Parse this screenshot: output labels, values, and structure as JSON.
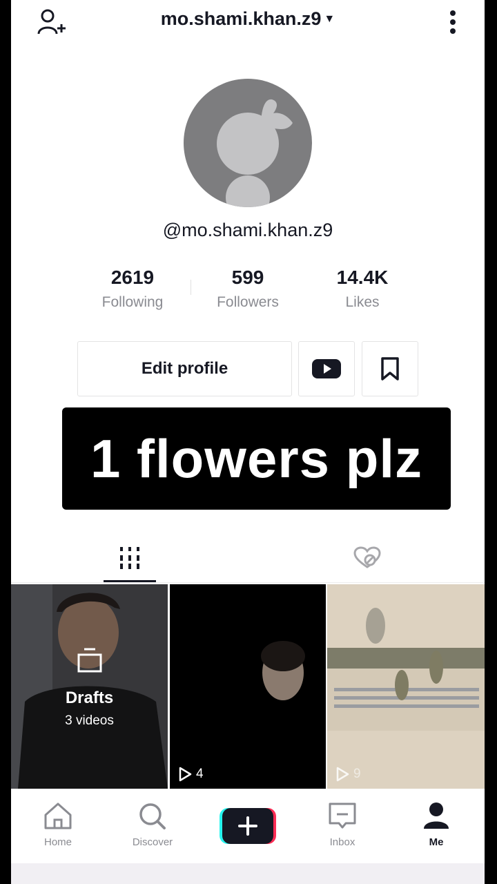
{
  "header": {
    "username": "mo.shami.khan.z9"
  },
  "profile": {
    "handle": "@mo.shami.khan.z9"
  },
  "stats": [
    {
      "value": "2619",
      "label": "Following"
    },
    {
      "value": "599",
      "label": "Followers"
    },
    {
      "value": "14.4K",
      "label": "Likes"
    }
  ],
  "buttons": {
    "edit_profile": "Edit profile"
  },
  "overlay": {
    "caption": "1 flowers plz"
  },
  "grid": {
    "drafts_title": "Drafts",
    "drafts_count": "3 videos",
    "videos": [
      {
        "plays": "4"
      },
      {
        "plays": "9"
      }
    ]
  },
  "nav": {
    "home": "Home",
    "discover": "Discover",
    "inbox": "Inbox",
    "me": "Me"
  },
  "colors": {
    "text": "#161823",
    "muted": "#8a8b91",
    "plus_cyan": "#25f4ee",
    "plus_pink": "#fe2c55"
  }
}
